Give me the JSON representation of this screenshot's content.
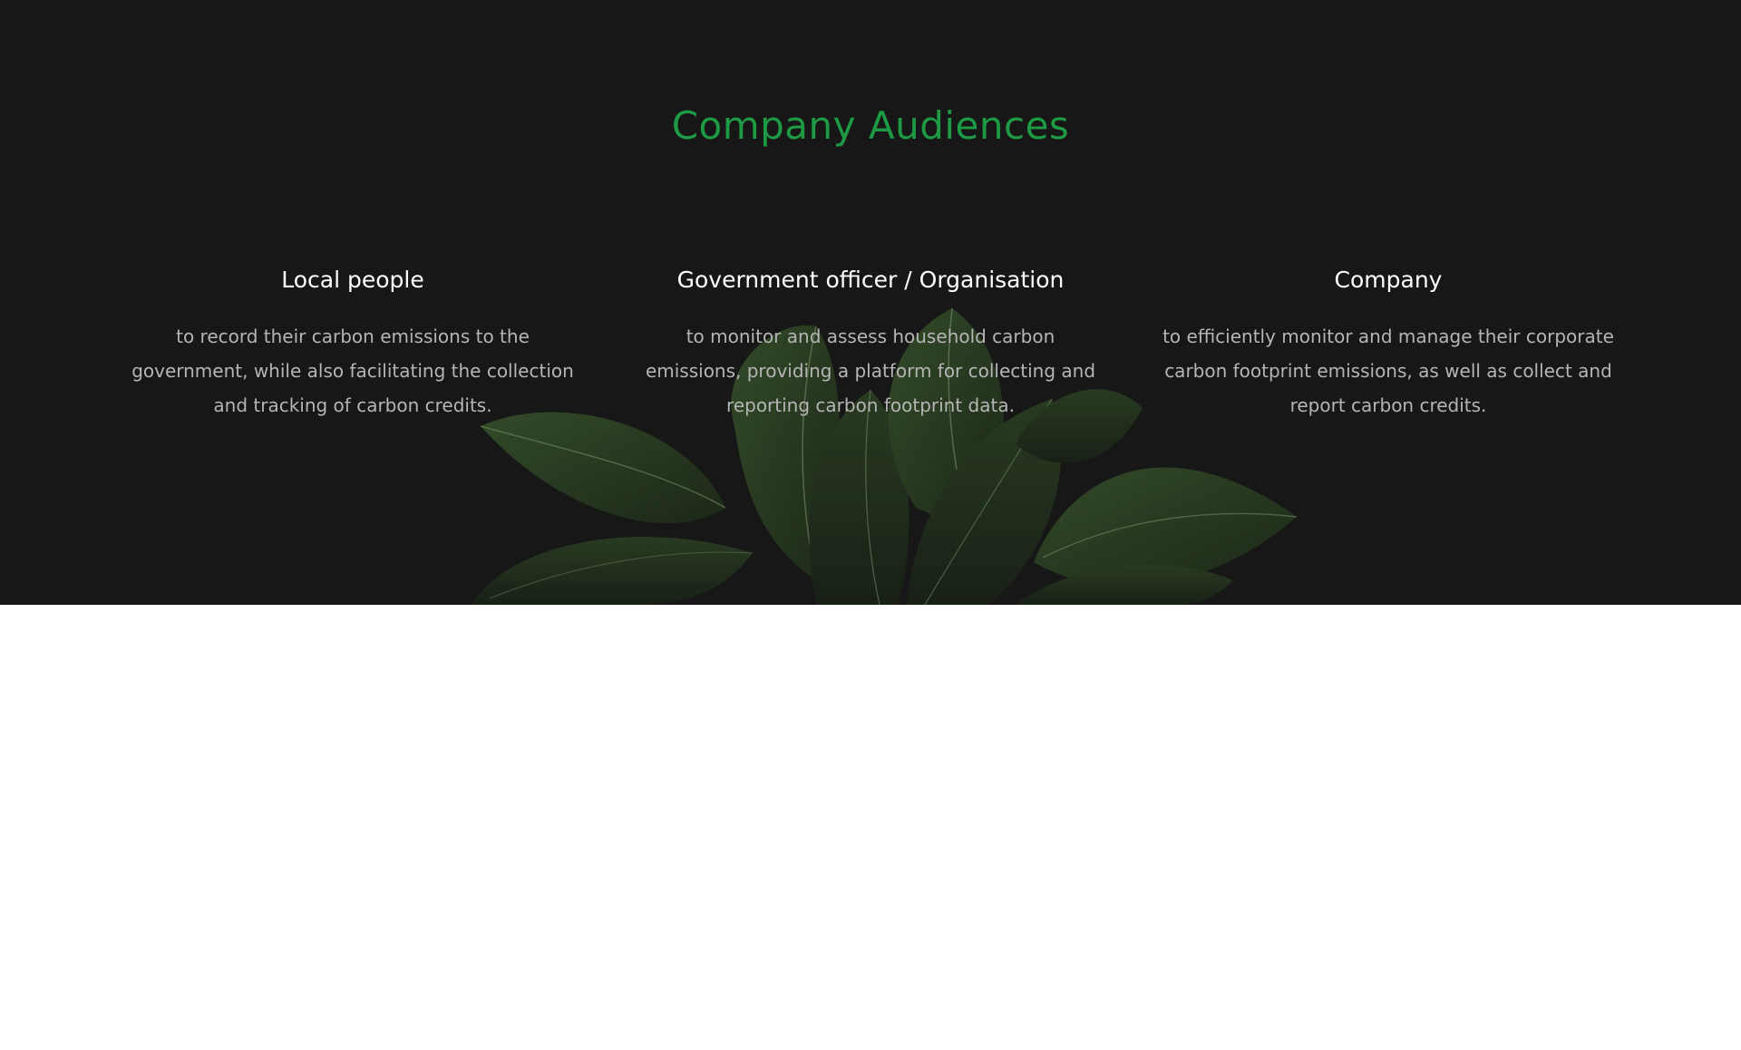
{
  "section": {
    "title": "Company Audiences",
    "accent_color": "#1d9a43",
    "background_color": "#171717"
  },
  "audiences": [
    {
      "title": "Local people",
      "description": "to record their carbon emissions to the government, while also facilitating the collection and tracking of carbon credits."
    },
    {
      "title": "Government officer / Organisation",
      "description": "to monitor and assess household carbon emissions, providing a platform for collecting and reporting carbon footprint data."
    },
    {
      "title": "Company",
      "description": "to efficiently monitor and manage their corporate carbon footprint emissions, as well as collect and report carbon credits."
    }
  ],
  "decoration": {
    "background_image": "plant-leaves-image"
  }
}
